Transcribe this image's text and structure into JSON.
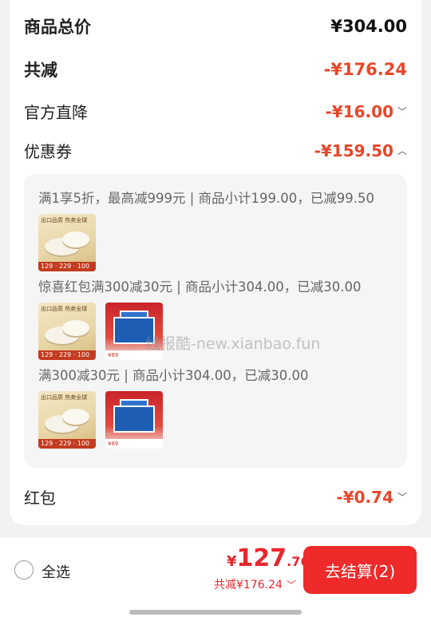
{
  "summary": {
    "total_label": "商品总价",
    "total_value": "¥304.00",
    "reduce_label": "共减",
    "reduce_value": "-¥176.24",
    "official_label": "官方直降",
    "official_value": "-¥16.00",
    "coupon_label": "优惠券",
    "coupon_value": "-¥159.50"
  },
  "coupons": [
    {
      "text": "满1享5折，最高减999元 | 商品小计199.00，已减99.50",
      "thumbs": [
        "pan"
      ]
    },
    {
      "text": "惊喜红包满300减30元 | 商品小计304.00，已减30.00",
      "thumbs": [
        "pan",
        "box"
      ]
    },
    {
      "text": "满300减30元 | 商品小计304.00，已减30.00",
      "thumbs": [
        "pan",
        "box"
      ]
    }
  ],
  "thumb_text": {
    "pan_header": "出口品质 热卖全球",
    "pan_tag": "129 · 229 · 100",
    "box_footer": "¥89"
  },
  "watermark": "线报酷-new.xianbao.fun",
  "hongbao": {
    "label": "红包",
    "value": "-¥0.74"
  },
  "bottom": {
    "select_all": "全选",
    "price_currency": "¥",
    "price_int": "127",
    "price_dec": ".76",
    "saved_text": "共减¥176.24",
    "checkout_label": "去结算(2)"
  },
  "colors": {
    "accent": "#e8462a",
    "checkout": "#ee2a2a"
  }
}
